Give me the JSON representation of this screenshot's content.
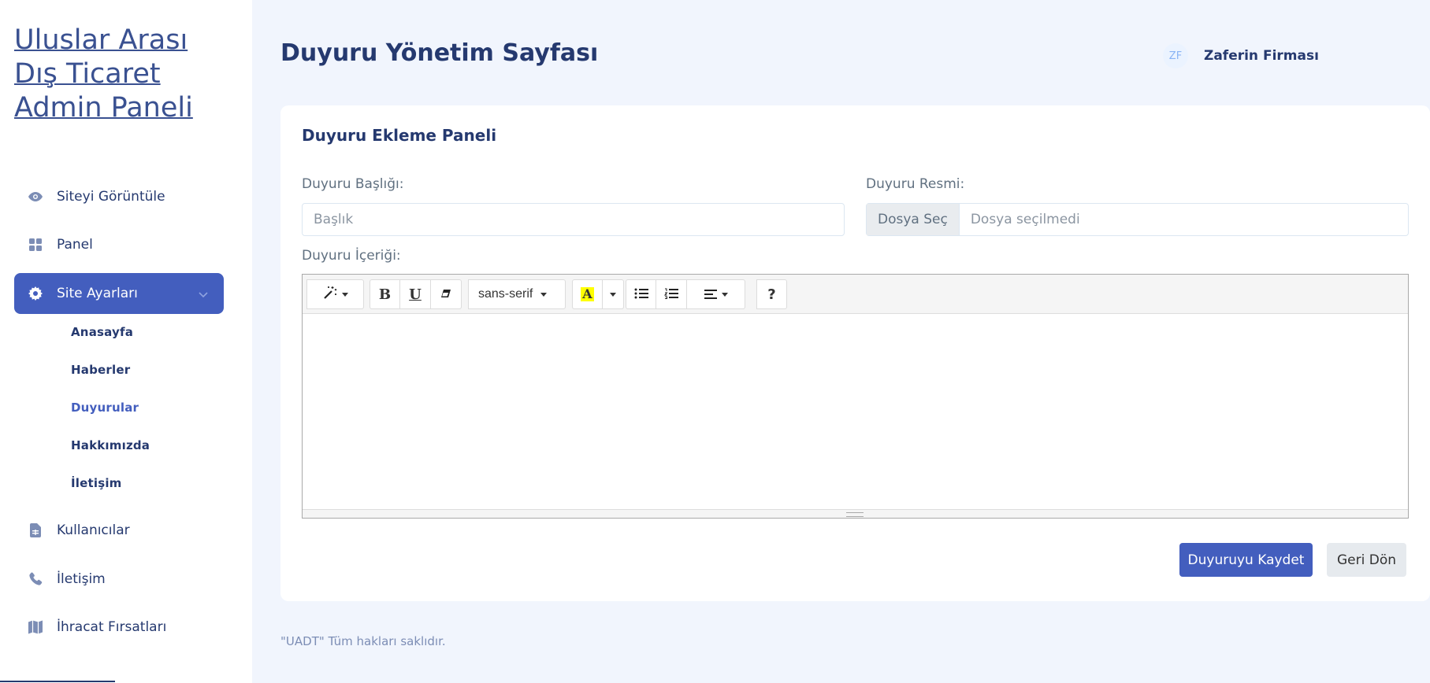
{
  "sidebar": {
    "brand": "Uluslar Arası Dış Ticaret Admin Paneli",
    "items": [
      {
        "label": "Siteyi Görüntüle",
        "icon": "eye-icon"
      },
      {
        "label": "Panel",
        "icon": "grid-icon"
      },
      {
        "label": "Site Ayarları",
        "icon": "gear-icon",
        "active": true
      },
      {
        "label": "Kullanıcılar",
        "icon": "file-icon"
      },
      {
        "label": "İletişim",
        "icon": "phone-icon"
      },
      {
        "label": "İhracat Fırsatları",
        "icon": "map-icon"
      }
    ],
    "submenu": [
      {
        "label": "Anasayfa"
      },
      {
        "label": "Haberler"
      },
      {
        "label": "Duyurular",
        "current": true
      },
      {
        "label": "Hakkımızda"
      },
      {
        "label": "İletişim"
      }
    ]
  },
  "header": {
    "title": "Duyuru Yönetim Sayfası",
    "user_initials": "ZF",
    "user_name": "Zaferin Firması"
  },
  "form": {
    "card_title": "Duyuru Ekleme Paneli",
    "title_label": "Duyuru Başlığı:",
    "title_placeholder": "Başlık",
    "image_label": "Duyuru Resmi:",
    "file_button": "Dosya Seç",
    "file_status": "Dosya seçilmedi",
    "content_label": "Duyuru İçeriği:",
    "toolbar": {
      "font_family": "sans-serif",
      "bold": "B",
      "underline": "U",
      "highlight": "A",
      "help": "?"
    },
    "save_button": "Duyuruyu Kaydet",
    "back_button": "Geri Dön"
  },
  "footer": {
    "text": "\"UADT\" Tüm hakları saklıdır."
  },
  "colors": {
    "primary": "#435ebe",
    "text_dark": "#25396f",
    "bg": "#f1f5fd"
  }
}
